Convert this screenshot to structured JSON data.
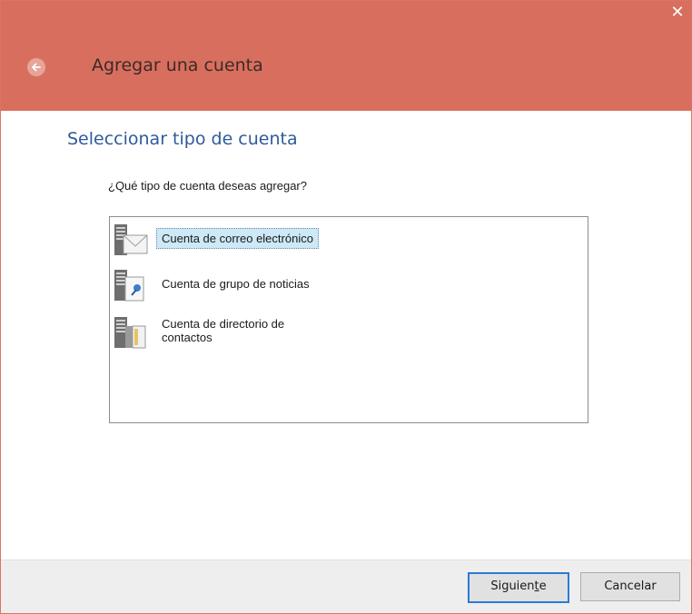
{
  "window": {
    "title": "Agregar una cuenta",
    "close_glyph": "✕",
    "accent_color": "#d86f5e"
  },
  "main": {
    "heading": "Seleccionar tipo de cuenta",
    "question": "¿Qué tipo de cuenta deseas agregar?",
    "account_types": [
      {
        "label": "Cuenta de correo electrónico",
        "icon": "mail-server-icon",
        "selected": true
      },
      {
        "label": "Cuenta de grupo de noticias",
        "icon": "news-server-icon",
        "selected": false
      },
      {
        "label": "Cuenta de directorio de\ncontactos",
        "icon": "directory-server-icon",
        "selected": false
      }
    ]
  },
  "footer": {
    "next_label_pre": "Siguien",
    "next_label_accel": "t",
    "next_label_post": "e",
    "cancel_label": "Cancelar"
  }
}
